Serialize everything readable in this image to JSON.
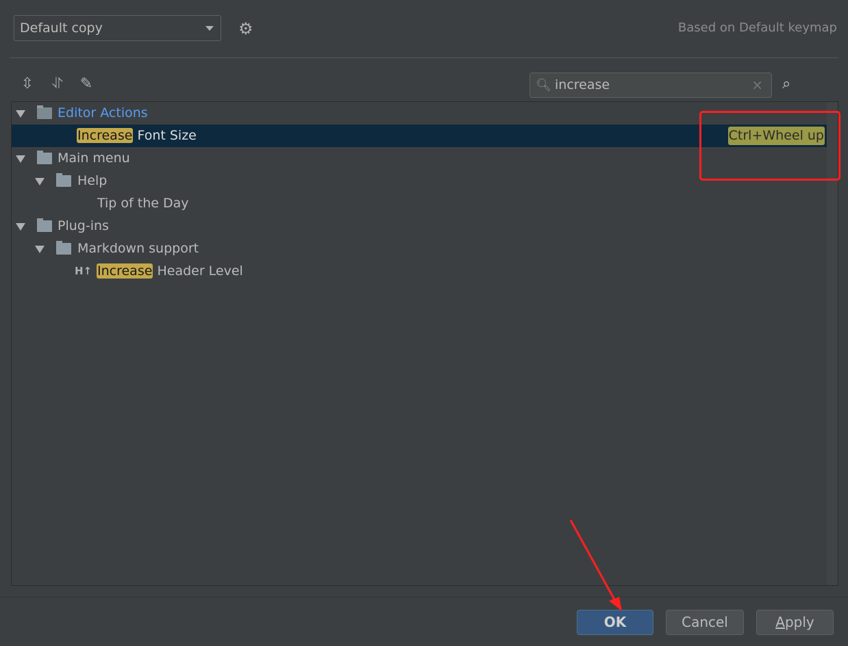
{
  "keymap": {
    "selected": "Default copy",
    "based_on": "Based on Default keymap"
  },
  "toolbar": {
    "icons": [
      "expand-all-icon",
      "collapse-all-icon",
      "edit-icon"
    ]
  },
  "search": {
    "value": "increase"
  },
  "tree": [
    {
      "label": "Editor Actions",
      "level": 0,
      "expanded": true,
      "color": "#589df6"
    },
    {
      "highlight": "Increase",
      "rest": " Font Size",
      "shortcut": "Ctrl+Wheel up",
      "selected": true
    },
    {
      "label": "Main menu",
      "level": 0,
      "expanded": true
    },
    {
      "label": "Help",
      "level": 1,
      "expanded": true
    },
    {
      "label": "Tip of the Day",
      "level": 2
    },
    {
      "label": "Plug-ins",
      "level": 0,
      "expanded": true
    },
    {
      "label": "Markdown support",
      "level": 1,
      "expanded": true
    },
    {
      "icon_text": "H↑",
      "highlight": "Increase",
      "rest": " Header Level"
    }
  ],
  "buttons": {
    "ok": "OK",
    "cancel": "Cancel",
    "apply_a": "A",
    "apply_rest": "pply"
  },
  "colors": {
    "background": "#3c3f41",
    "selection": "#0d293e",
    "match_highlight": "#c4a84a",
    "annotation": "#ff2020"
  }
}
